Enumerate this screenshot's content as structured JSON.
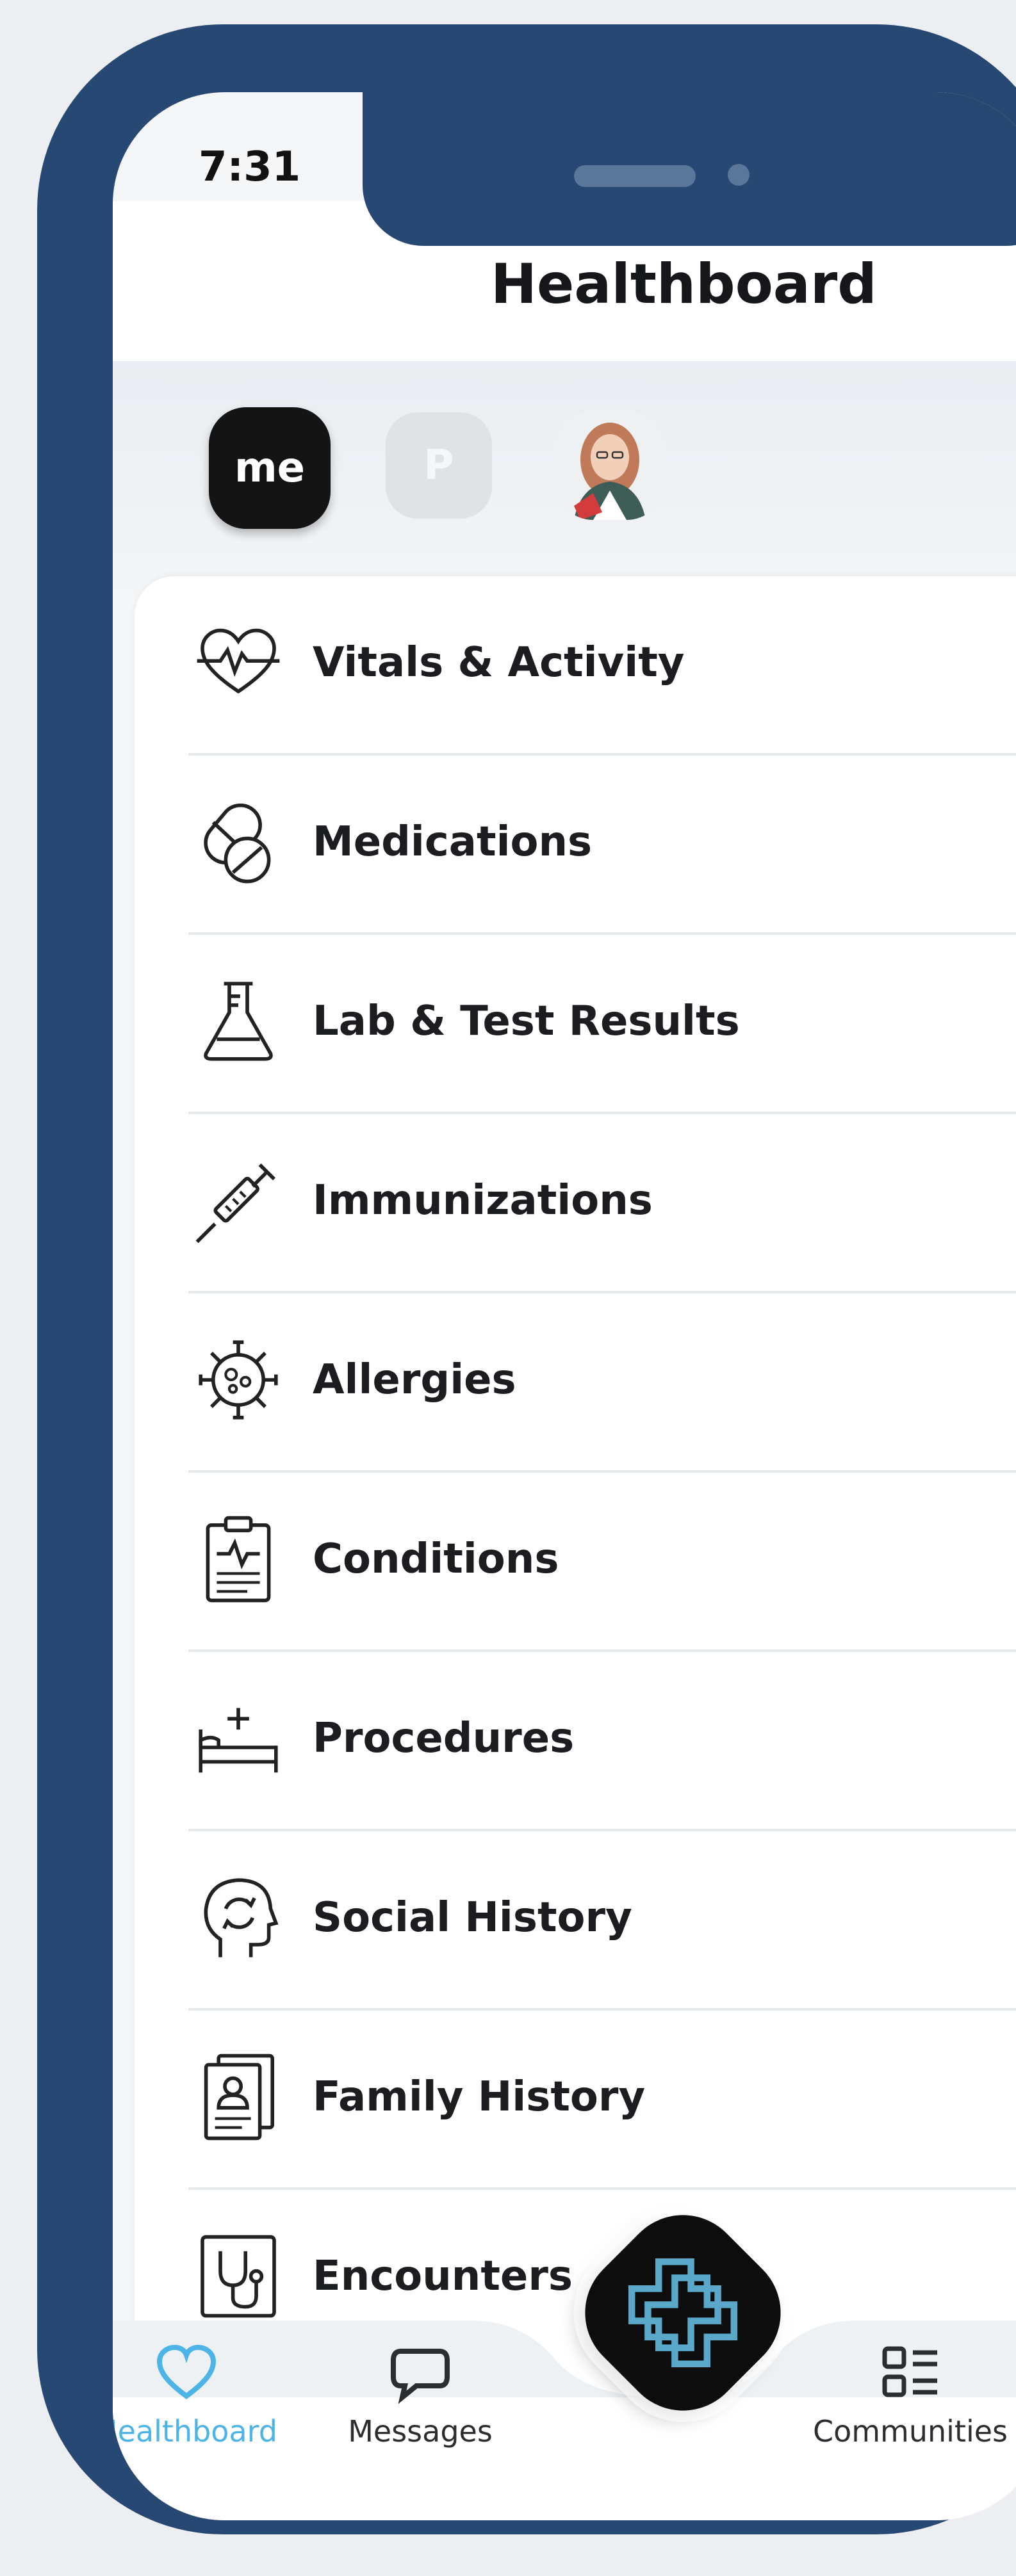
{
  "status": {
    "time": "7:31"
  },
  "header": {
    "title": "Healthboard"
  },
  "profiles": [
    {
      "label": "me",
      "selected": true
    },
    {
      "label": "P",
      "selected": false
    },
    {
      "type": "avatar-photo"
    }
  ],
  "categories": [
    {
      "label": "Vitals & Activity",
      "icon": "heart-pulse-icon"
    },
    {
      "label": "Medications",
      "icon": "pills-icon"
    },
    {
      "label": "Lab & Test Results",
      "icon": "flask-icon"
    },
    {
      "label": "Immunizations",
      "icon": "syringe-icon"
    },
    {
      "label": "Allergies",
      "icon": "virus-icon"
    },
    {
      "label": "Conditions",
      "icon": "clipboard-pulse-icon"
    },
    {
      "label": "Procedures",
      "icon": "hospital-bed-icon"
    },
    {
      "label": "Social History",
      "icon": "head-sync-icon"
    },
    {
      "label": "Family History",
      "icon": "family-records-icon"
    },
    {
      "label": "Encounters",
      "icon": "stethoscope-doc-icon"
    }
  ],
  "tabbar": {
    "healthboard": "Healthboard",
    "messages": "Messages",
    "communities": "Communities"
  },
  "colors": {
    "frame": "#274872",
    "accent": "#4cb4e6",
    "text": "#1c1d20",
    "tab_inactive": "#2b2d31"
  }
}
